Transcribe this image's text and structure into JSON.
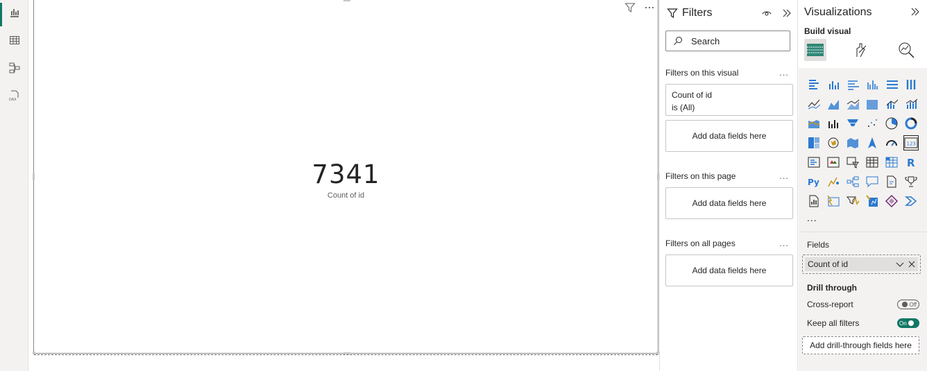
{
  "card": {
    "value": "7341",
    "label": "Count of id"
  },
  "filters_pane": {
    "title": "Filters",
    "search_placeholder": "Search",
    "sections": {
      "visual": {
        "title": "Filters on this visual",
        "more": "...",
        "field_name": "Count of id",
        "field_state": "is (All)",
        "drop_label": "Add data fields here"
      },
      "page": {
        "title": "Filters on this page",
        "more": "...",
        "drop_label": "Add data fields here"
      },
      "all_pages": {
        "title": "Filters on all pages",
        "more": "...",
        "drop_label": "Add data fields here"
      }
    }
  },
  "viz_pane": {
    "title": "Visualizations",
    "build_label": "Build visual",
    "more": "...",
    "fields_label": "Fields",
    "field_pill": "Count of id",
    "drill_label": "Drill through",
    "cross_report_label": "Cross-report",
    "cross_report_toggle": "Off",
    "keep_filters_label": "Keep all filters",
    "keep_filters_toggle": "On",
    "drill_drop_label": "Add drill-through fields here",
    "icons": [
      "stacked-bar-icon",
      "stacked-column-icon",
      "clustered-bar-icon",
      "clustered-column-icon",
      "100-bar-icon",
      "100-column-icon",
      "line-chart-icon",
      "area-chart-icon",
      "stacked-area-icon",
      "100-area-icon",
      "line-clustered-column-icon",
      "line-stacked-column-icon",
      "ribbon-chart-icon",
      "waterfall-chart-icon",
      "funnel-chart-icon",
      "scatter-chart-icon",
      "pie-chart-icon",
      "donut-chart-icon",
      "treemap-icon",
      "map-icon",
      "filled-map-icon",
      "azure-map-icon",
      "gauge-icon",
      "card-icon",
      "multi-row-card-icon",
      "kpi-icon",
      "slicer-icon",
      "table-icon",
      "matrix-icon",
      "r-visual-icon",
      "python-visual-icon",
      "key-influencers-icon",
      "decomposition-tree-icon",
      "qa-icon",
      "smart-narrative-icon",
      "metrics-icon",
      "paginated-report-icon",
      "power-apps-icon",
      "power-automate-icon",
      "arcgis-icon",
      "power-apps-logo-icon",
      "power-automate-logo-icon"
    ]
  },
  "colors": {
    "accent": "#117865",
    "chart_blue": "#2b79d1",
    "chart_gold": "#c79a1d"
  }
}
